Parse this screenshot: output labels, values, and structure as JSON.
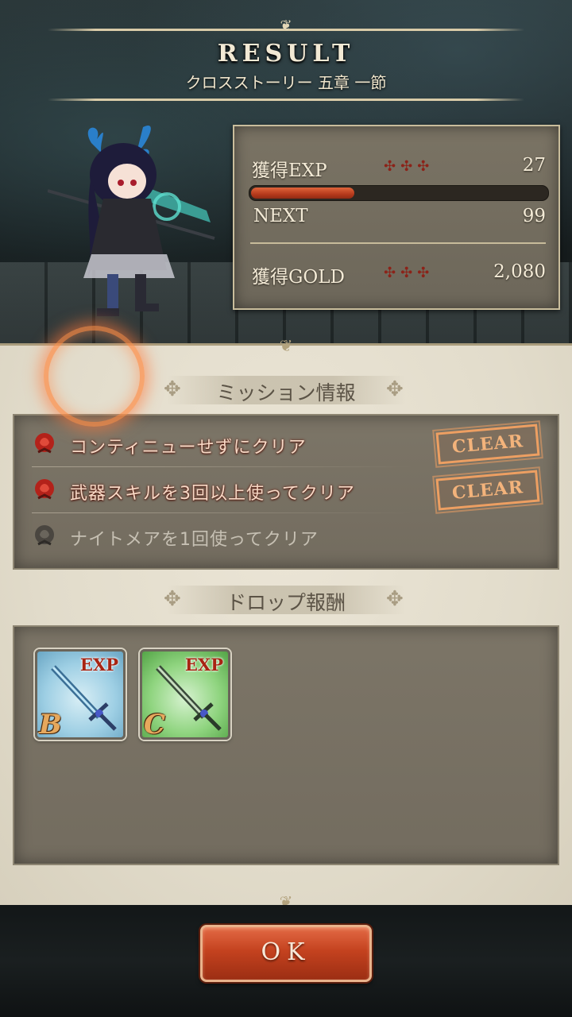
{
  "header": {
    "title": "RESULT",
    "subtitle": "クロスストーリー 五章 一節"
  },
  "stats": {
    "exp_label": "獲得EXP",
    "exp_value": "27",
    "exp_progress": 0.35,
    "next_label": "NEXT",
    "next_value": "99",
    "gold_label": "獲得GOLD",
    "gold_value": "2,080",
    "dots": "✣✣✣"
  },
  "missions": {
    "section_title": "ミッション情報",
    "items": [
      {
        "text": "コンティニューせずにクリア",
        "cleared": true,
        "badge": "CLEAR"
      },
      {
        "text": "武器スキルを3回以上使ってクリア",
        "cleared": true,
        "badge": "CLEAR"
      },
      {
        "text": "ナイトメアを1回使ってクリア",
        "cleared": false,
        "badge": ""
      }
    ]
  },
  "drops": {
    "section_title": "ドロップ報酬",
    "items": [
      {
        "tag": "EXP",
        "rank": "B",
        "color": "#5fb3d8"
      },
      {
        "tag": "EXP",
        "rank": "C",
        "color": "#4fc24a"
      }
    ]
  },
  "ok_button": {
    "label": "OK"
  },
  "colors": {
    "accent_red": "#c4421f",
    "clear_orange": "#ed9f62",
    "parchment": "#e2dccb"
  }
}
